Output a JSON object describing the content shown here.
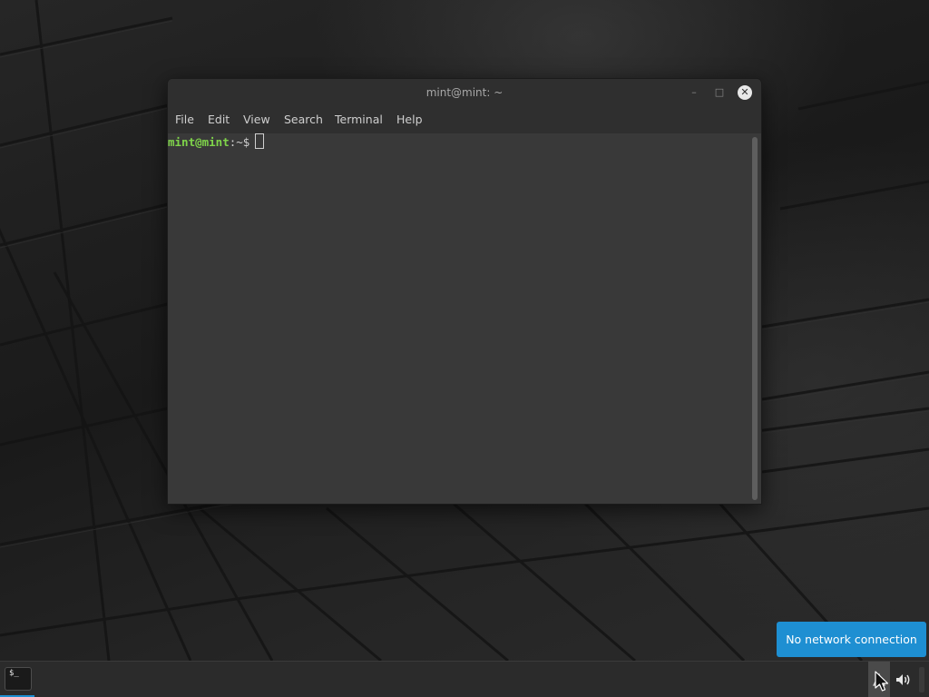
{
  "window": {
    "title": "mint@mint: ~",
    "minimize_icon": "minimize-icon",
    "maximize_icon": "maximize-icon",
    "close_icon": "close-icon",
    "menu": [
      "File",
      "Edit",
      "View",
      "Search",
      "Terminal",
      "Help"
    ]
  },
  "terminal": {
    "user_host": "mint@mint",
    "colon": ":",
    "path": "~",
    "dollar": "$",
    "prompt_color": "#7fd44a"
  },
  "notification": {
    "text": "No network connection",
    "color": "#1e8fd2"
  },
  "taskbar": {
    "terminal_icon": "terminal-icon",
    "terminal_glyph": "$_",
    "network_icon": "network-disconnected-icon",
    "volume_icon": "volume-icon",
    "accent": "#1e8fd2"
  }
}
